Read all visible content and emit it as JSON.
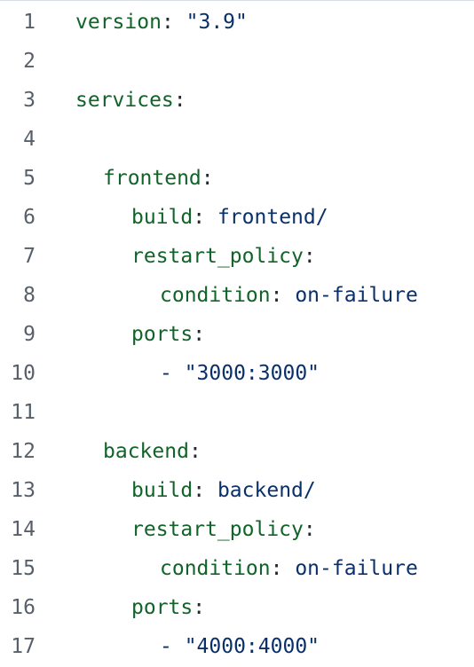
{
  "editor": {
    "lines": [
      {
        "number": "1",
        "key": "version",
        "sep": ": ",
        "value": "\"3.9\""
      },
      {
        "number": "2"
      },
      {
        "number": "3",
        "key": "services",
        "sep": ":"
      },
      {
        "number": "4"
      },
      {
        "number": "5",
        "key": "frontend",
        "sep": ":"
      },
      {
        "number": "6",
        "key": "build",
        "sep": ": ",
        "value": "frontend/"
      },
      {
        "number": "7",
        "key": "restart_policy",
        "sep": ":"
      },
      {
        "number": "8",
        "key": "condition",
        "sep": ": ",
        "value": "on-failure"
      },
      {
        "number": "9",
        "key": "ports",
        "sep": ":"
      },
      {
        "number": "10",
        "value": "- \"3000:3000\""
      },
      {
        "number": "11"
      },
      {
        "number": "12",
        "key": "backend",
        "sep": ":"
      },
      {
        "number": "13",
        "key": "build",
        "sep": ": ",
        "value": "backend/"
      },
      {
        "number": "14",
        "key": "restart_policy",
        "sep": ":"
      },
      {
        "number": "15",
        "key": "condition",
        "sep": ": ",
        "value": "on-failure"
      },
      {
        "number": "16",
        "key": "ports",
        "sep": ":"
      },
      {
        "number": "17",
        "value": "- \"4000:4000\""
      }
    ]
  }
}
